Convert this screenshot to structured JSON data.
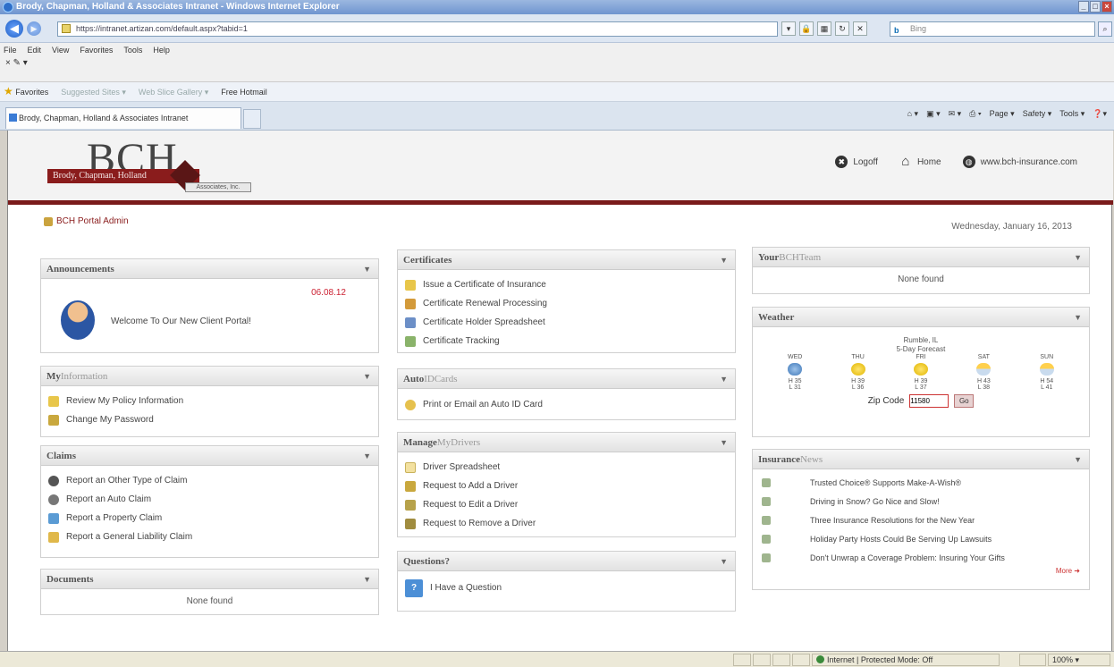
{
  "browser": {
    "title": "Brody, Chapman, Holland & Associates Intranet - Windows Internet Explorer",
    "address": "https://intranet.artizan.com/default.aspx?tabid=1",
    "search_label": "Bing",
    "menu": [
      "File",
      "Edit",
      "View",
      "Favorites",
      "Tools",
      "Help"
    ],
    "favorites": {
      "label": "Favorites",
      "items": [
        "Suggested Sites ▾",
        "Web Slice Gallery ▾",
        "Free Hotmail"
      ]
    },
    "tab_title": "Brody, Chapman, Holland & Associates Intranet",
    "command_bar": [
      "Page ▾",
      "Safety ▾",
      "Tools ▾"
    ],
    "status": {
      "zone": "Internet | Protected Mode: Off",
      "zoom": "100% ▾"
    }
  },
  "header": {
    "logo_main": "BCH",
    "logo_bar": "Brody, Chapman, Holland",
    "logo_sub": "Associates, Inc.",
    "nav": [
      {
        "label": "Logoff",
        "icon": "logoff-icon"
      },
      {
        "label": "Home",
        "icon": "home-icon"
      },
      {
        "label": "www.bch-insurance.com",
        "icon": "globe-icon"
      }
    ]
  },
  "user": {
    "label": "BCH Portal Admin"
  },
  "date": "Wednesday, January 16, 2013",
  "announcements": {
    "title": "Announcements",
    "date": "06.08.12",
    "message": "Welcome To Our New Client Portal!"
  },
  "my_information": {
    "title_strong": "My",
    "title_light": "Information",
    "items": [
      "Review My Policy Information",
      "Change My Password"
    ]
  },
  "claims": {
    "title": "Claims",
    "items": [
      "Report an Other Type of Claim",
      "Report an Auto Claim",
      "Report a Property Claim",
      "Report a General Liability Claim"
    ]
  },
  "documents": {
    "title": "Documents",
    "empty": "None found"
  },
  "certificates": {
    "title": "Certificates",
    "items": [
      "Issue a Certificate of Insurance",
      "Certificate Renewal Processing",
      "Certificate Holder Spreadsheet",
      "Certificate Tracking"
    ]
  },
  "auto_id": {
    "title_strong": "Auto",
    "title_light": "IDCards",
    "items": [
      "Print or Email an Auto ID Card"
    ]
  },
  "manage_drivers": {
    "title_strong": "Manage",
    "title_light": "MyDrivers",
    "items": [
      "Driver Spreadsheet",
      "Request to Add a Driver",
      "Request to Edit a Driver",
      "Request to Remove a Driver"
    ]
  },
  "questions": {
    "title": "Questions?",
    "items": [
      "I Have a Question"
    ]
  },
  "team": {
    "title_strong": "Your",
    "title_light": "BCHTeam",
    "empty": "None found"
  },
  "weather": {
    "title": "Weather",
    "location": "Rumble, IL",
    "subtitle": "5-Day Forecast",
    "days": [
      {
        "day": "WED",
        "icon": "cloud-icon",
        "high": "H 35",
        "low": "L 31"
      },
      {
        "day": "THU",
        "icon": "sun-icon",
        "high": "H 39",
        "low": "L 36"
      },
      {
        "day": "FRI",
        "icon": "sun-icon",
        "high": "H 39",
        "low": "L 37"
      },
      {
        "day": "SAT",
        "icon": "partly-cloudy-icon",
        "high": "H 43",
        "low": "L 38"
      },
      {
        "day": "SUN",
        "icon": "partly-cloudy-icon",
        "high": "H 54",
        "low": "L 41"
      }
    ],
    "zip_label": "Zip Code",
    "zip_value": "11580",
    "go_label": "Go"
  },
  "insurance_news": {
    "title_strong": "Insurance",
    "title_light": "News",
    "items": [
      "Trusted Choice® Supports Make-A-Wish®",
      "Driving in Snow? Go Nice and Slow!",
      "Three Insurance Resolutions for the New Year",
      "Holiday Party Hosts Could Be Serving Up Lawsuits",
      "Don't Unwrap a Coverage Problem: Insuring Your Gifts"
    ],
    "more": "More"
  },
  "colors": {
    "brand": "#8a1c1c",
    "accent_line": "#7a1b1b"
  }
}
